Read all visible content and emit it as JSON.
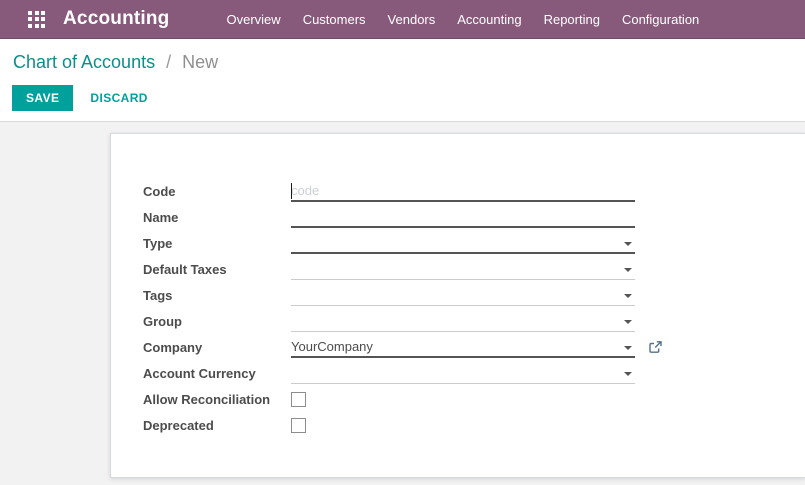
{
  "topbar": {
    "app_title": "Accounting",
    "menus": [
      "Overview",
      "Customers",
      "Vendors",
      "Accounting",
      "Reporting",
      "Configuration"
    ]
  },
  "breadcrumb": {
    "parent": "Chart of Accounts",
    "separator": "/",
    "current": "New"
  },
  "actions": {
    "save": "SAVE",
    "discard": "DISCARD"
  },
  "form": {
    "fields": [
      {
        "label": "Code",
        "widget": "text",
        "value": "",
        "placeholder": "code",
        "required": true,
        "focused": true
      },
      {
        "label": "Name",
        "widget": "text",
        "value": "",
        "placeholder": "",
        "required": true
      },
      {
        "label": "Type",
        "widget": "dropdown",
        "value": "",
        "required": true
      },
      {
        "label": "Default Taxes",
        "widget": "dropdown",
        "value": "",
        "required": false
      },
      {
        "label": "Tags",
        "widget": "dropdown",
        "value": "",
        "required": false
      },
      {
        "label": "Group",
        "widget": "dropdown",
        "value": "",
        "required": false
      },
      {
        "label": "Company",
        "widget": "dropdown",
        "value": "YourCompany",
        "required": true,
        "external_link": true
      },
      {
        "label": "Account Currency",
        "widget": "dropdown",
        "value": "",
        "required": false
      },
      {
        "label": "Allow Reconciliation",
        "widget": "checkbox",
        "checked": false
      },
      {
        "label": "Deprecated",
        "widget": "checkbox",
        "checked": false
      }
    ]
  },
  "icons": {
    "apps_grid": "3x3-square-grid",
    "dropdown_caret": "triangle-down",
    "external_link": "box-with-arrow-out"
  },
  "colors": {
    "topbar_bg": "#875A7B",
    "primary_button": "#00A09D",
    "breadcrumb_link": "#0C8E8A",
    "label_text": "#4C4C4C",
    "content_bg": "#F2F2F2"
  }
}
